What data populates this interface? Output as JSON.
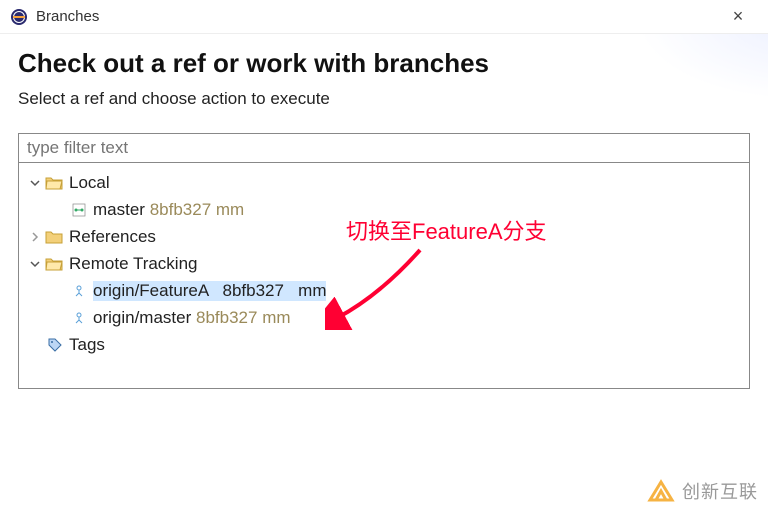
{
  "titlebar": {
    "title": "Branches",
    "close": "×"
  },
  "header": {
    "heading": "Check out a ref or work with branches",
    "subheading": "Select a ref and choose action to execute"
  },
  "filter": {
    "placeholder": "type filter text"
  },
  "tree": {
    "local": {
      "label": "Local",
      "expanded": true
    },
    "master": {
      "name": "master",
      "hash": "8bfb327",
      "msg": "mm"
    },
    "references": {
      "label": "References",
      "expanded": false
    },
    "remote_tracking": {
      "label": "Remote Tracking",
      "expanded": true
    },
    "origin_feature": {
      "name": "origin/FeatureA",
      "hash": "8bfb327",
      "msg": "mm",
      "selected": true
    },
    "origin_master": {
      "name": "origin/master",
      "hash": "8bfb327",
      "msg": "mm"
    },
    "tags": {
      "label": "Tags"
    }
  },
  "annotation": {
    "text": "切换至FeatureA分支"
  },
  "watermark": {
    "text": "创新互联"
  }
}
